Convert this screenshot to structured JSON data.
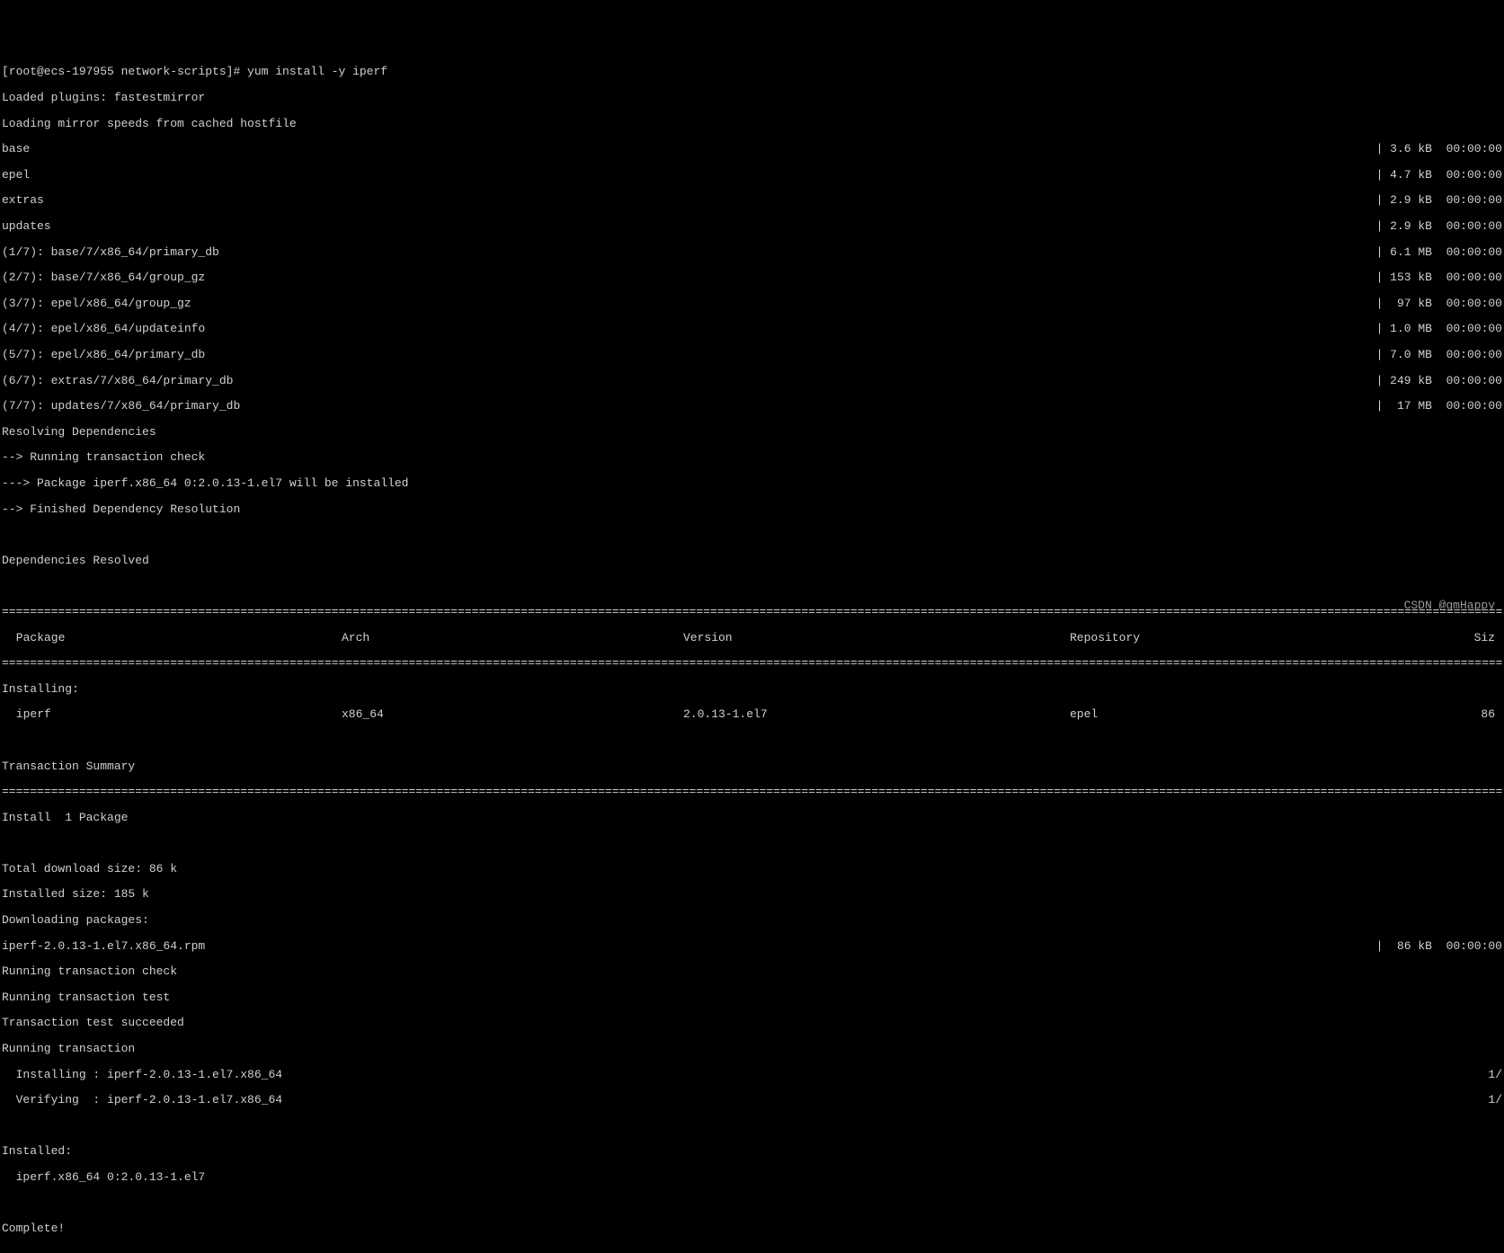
{
  "prompt": "[root@ecs-197955 network-scripts]# yum install -y iperf",
  "loaded_plugins": "Loaded plugins: fastestmirror",
  "loading_mirror": "Loading mirror speeds from cached hostfile",
  "repos": [
    {
      "name": "base",
      "size": "| 3.6 kB  00:00:00"
    },
    {
      "name": "epel",
      "size": "| 4.7 kB  00:00:00"
    },
    {
      "name": "extras",
      "size": "| 2.9 kB  00:00:00"
    },
    {
      "name": "updates",
      "size": "| 2.9 kB  00:00:00"
    }
  ],
  "downloads": [
    {
      "name": "(1/7): base/7/x86_64/primary_db",
      "size": "| 6.1 MB  00:00:00"
    },
    {
      "name": "(2/7): base/7/x86_64/group_gz",
      "size": "| 153 kB  00:00:00"
    },
    {
      "name": "(3/7): epel/x86_64/group_gz",
      "size": "|  97 kB  00:00:00"
    },
    {
      "name": "(4/7): epel/x86_64/updateinfo",
      "size": "| 1.0 MB  00:00:00"
    },
    {
      "name": "(5/7): epel/x86_64/primary_db",
      "size": "| 7.0 MB  00:00:00"
    },
    {
      "name": "(6/7): extras/7/x86_64/primary_db",
      "size": "| 249 kB  00:00:00"
    },
    {
      "name": "(7/7): updates/7/x86_64/primary_db",
      "size": "|  17 MB  00:00:00"
    }
  ],
  "resolving": "Resolving Dependencies",
  "running_check": "--> Running transaction check",
  "pkg_line": "---> Package iperf.x86_64 0:2.0.13-1.el7 will be installed",
  "finished_dep": "--> Finished Dependency Resolution",
  "deps_resolved": "Dependencies Resolved",
  "header": {
    "pkg": " Package",
    "arch": "Arch",
    "ver": "Version",
    "repo": "Repository",
    "size": "Siz"
  },
  "installing_label": "Installing:",
  "row": {
    "pkg": " iperf",
    "arch": "x86_64",
    "ver": "2.0.13-1.el7",
    "repo": "epel",
    "size": "86"
  },
  "trans_summary": "Transaction Summary",
  "install_count": "Install  1 Package",
  "total_dl": "Total download size: 86 k",
  "installed_size": "Installed size: 185 k",
  "downloading_pkg": "Downloading packages:",
  "rpm_line": {
    "left": "iperf-2.0.13-1.el7.x86_64.rpm",
    "right": "|  86 kB  00:00:00"
  },
  "run_trans_check": "Running transaction check",
  "run_trans_test": "Running transaction test",
  "trans_test_ok": "Transaction test succeeded",
  "run_trans": "Running transaction",
  "installing_step": {
    "left": "  Installing : iperf-2.0.13-1.el7.x86_64",
    "right": "1/"
  },
  "verifying_step": {
    "left": "  Verifying  : iperf-2.0.13-1.el7.x86_64",
    "right": "1/"
  },
  "installed_label": "Installed:",
  "installed_pkg": "  iperf.x86_64 0:2.0.13-1.el7",
  "complete": "Complete!",
  "watermark": "CSDN @gmHappy",
  "divider": "================================================================================================================================================================================================================================================================================================="
}
